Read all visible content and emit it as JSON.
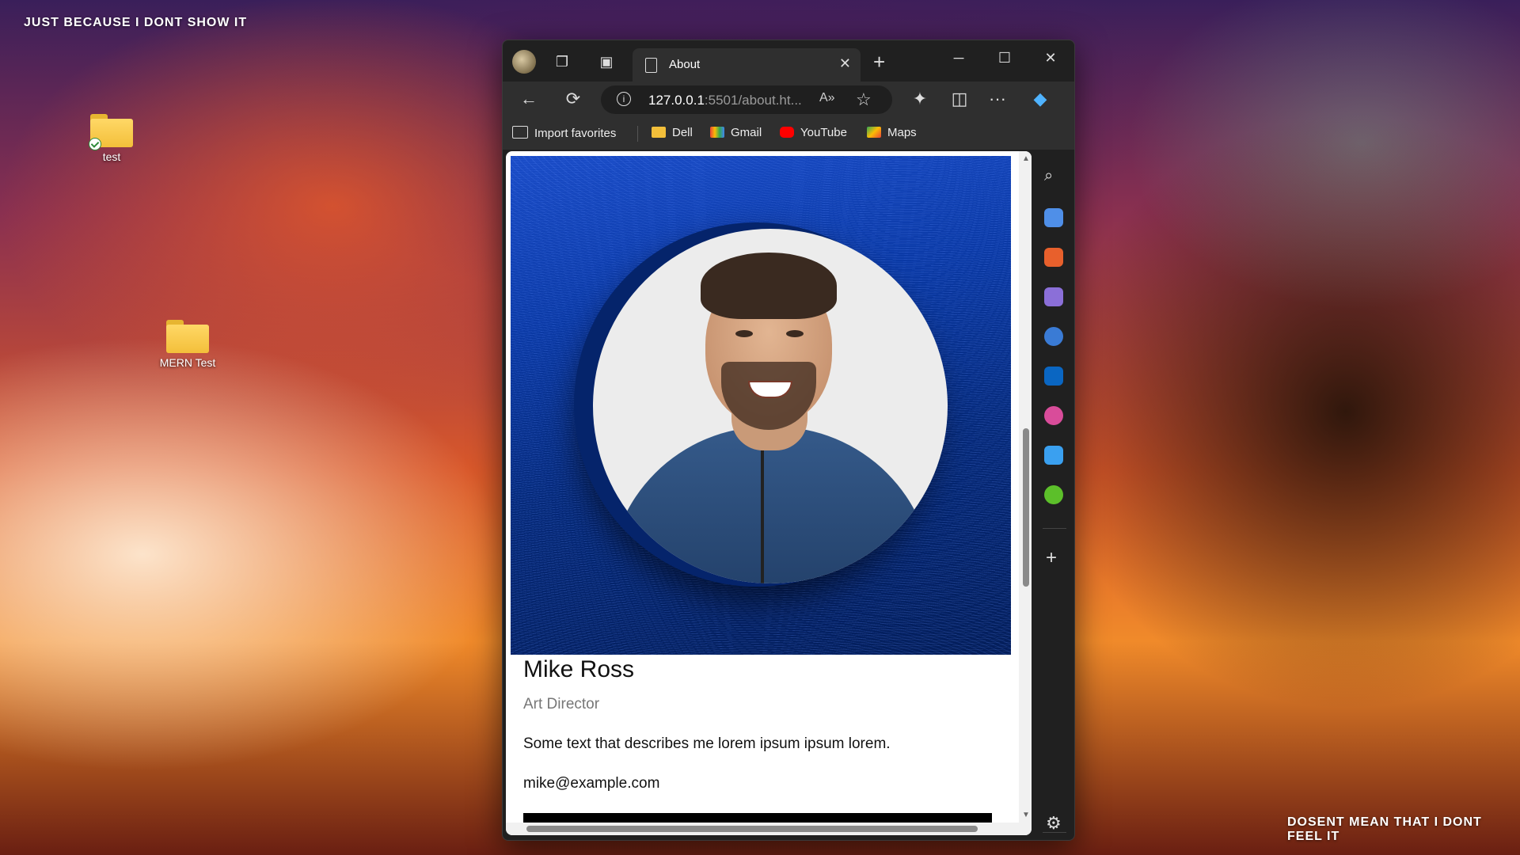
{
  "wallpaper": {
    "top_text": "JUST BECAUSE I DONT SHOW IT",
    "bottom_text": "DOSENT MEAN THAT I DONT FEEL IT"
  },
  "desktop": {
    "icons": [
      {
        "label": "test",
        "icon": "folder-icon",
        "synced": true
      },
      {
        "label": "MERN Test",
        "icon": "folder-icon",
        "synced": false
      }
    ]
  },
  "browser": {
    "tab": {
      "title": "About",
      "close": "✕"
    },
    "new_tab": "+",
    "window_controls": {
      "minimize": "─",
      "maximize": "☐",
      "close": "✕"
    },
    "nav": {
      "back": "←",
      "refresh": "⟳",
      "more": "···"
    },
    "address": {
      "host": "127.0.0.1",
      "rest": ":5501/about.ht...",
      "read_aloud": "A»",
      "favorite": "☆"
    },
    "favorites": [
      {
        "label": "Import favorites",
        "icon": "import-icon"
      },
      {
        "label": "Dell",
        "icon": "folder-icon"
      },
      {
        "label": "Gmail",
        "icon": "gmail-icon"
      },
      {
        "label": "YouTube",
        "icon": "youtube-icon"
      },
      {
        "label": "Maps",
        "icon": "maps-icon"
      }
    ],
    "sidebar": {
      "add": "+",
      "settings": "⚙"
    },
    "colors": {
      "accent": "#0b3aa6",
      "frame": "#202020"
    }
  },
  "profile": {
    "name": "Mike Ross",
    "title": "Art Director",
    "description": "Some text that describes me lorem ipsum ipsum lorem.",
    "email": "mike@example.com"
  }
}
